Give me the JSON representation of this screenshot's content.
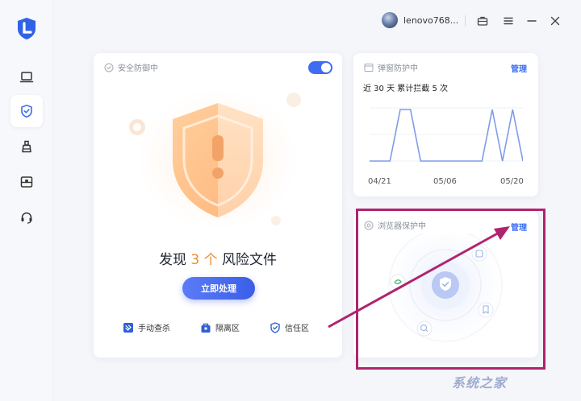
{
  "app": {
    "logo_letter": "L"
  },
  "sidebar": {
    "items": [
      {
        "id": "laptop",
        "icon": "laptop-icon",
        "active": false
      },
      {
        "id": "security",
        "icon": "shield-check-icon",
        "active": true
      },
      {
        "id": "cleanup",
        "icon": "brush-icon",
        "active": false
      },
      {
        "id": "toolbox",
        "icon": "toolbox-icon",
        "active": false
      },
      {
        "id": "support",
        "icon": "headset-icon",
        "active": false
      }
    ]
  },
  "topbar": {
    "username": "lenovo768...",
    "icons": [
      "briefcase-icon",
      "menu-icon",
      "minimize-icon",
      "close-icon"
    ]
  },
  "security_card": {
    "status_label": "安全防御中",
    "toggle_on": true,
    "risk_prefix": "发现",
    "risk_count": "3 个",
    "risk_suffix": "风险文件",
    "action_button": "立即处理",
    "tools": [
      {
        "label": "手动查杀",
        "icon": "scan-icon"
      },
      {
        "label": "隔离区",
        "icon": "lock-box-icon"
      },
      {
        "label": "信任区",
        "icon": "shield-check-icon"
      }
    ]
  },
  "popup_card": {
    "title": "弹窗防护中",
    "manage": "管理",
    "stat": "近 30 天 累计拦截 5 次",
    "dates": [
      "04/21",
      "05/06",
      "05/20"
    ],
    "chart_data": {
      "type": "line",
      "x": [
        "04/21",
        "05/06",
        "05/20"
      ],
      "series": [
        {
          "values": [
            0,
            0,
            0,
            5,
            5,
            0,
            0,
            0,
            0,
            0,
            0,
            0,
            5,
            0,
            5,
            0
          ]
        }
      ],
      "grid": true
    }
  },
  "browser_card": {
    "title": "浏览器保护中",
    "manage": "管理"
  },
  "watermark": "系统之家",
  "colors": {
    "accent": "#3f6cf0",
    "risk": "#f08a2a",
    "highlight": "#b0236e"
  }
}
